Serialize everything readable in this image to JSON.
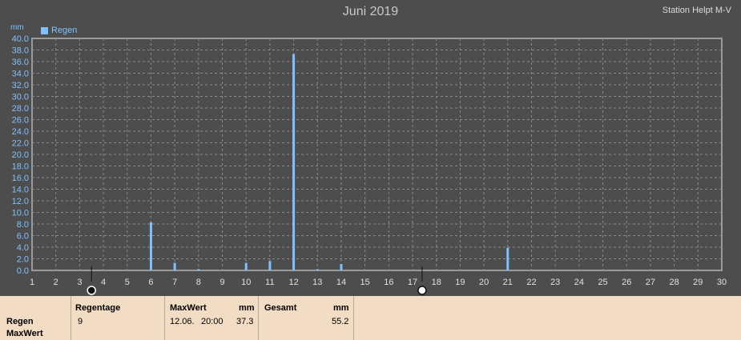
{
  "title": "Juni 2019",
  "station": "Station Helpt M-V",
  "unit": "mm",
  "legend_label": "Regen",
  "colors": {
    "bar": "#7fc0ff",
    "plot_bg": "#4d4d4d",
    "grid": "#8a8a8a",
    "panel_bg": "#f2dcc4"
  },
  "chart_data": {
    "type": "bar",
    "title": "Juni 2019",
    "ylabel": "mm",
    "xlabel": "",
    "series": [
      {
        "name": "Regen",
        "points": [
          {
            "x": 6,
            "y": 8.3
          },
          {
            "x": 7,
            "y": 1.3
          },
          {
            "x": 8,
            "y": 0.2
          },
          {
            "x": 10,
            "y": 1.3
          },
          {
            "x": 11,
            "y": 1.6
          },
          {
            "x": 12,
            "y": 37.3
          },
          {
            "x": 13,
            "y": 0.2
          },
          {
            "x": 14,
            "y": 1.1
          },
          {
            "x": 21,
            "y": 3.9
          }
        ]
      }
    ],
    "xlim": [
      1,
      30
    ],
    "xticks": [
      1,
      2,
      3,
      4,
      5,
      6,
      7,
      8,
      9,
      10,
      11,
      12,
      13,
      14,
      15,
      16,
      17,
      18,
      19,
      20,
      21,
      22,
      23,
      24,
      25,
      26,
      27,
      28,
      29,
      30
    ],
    "ylim": [
      0,
      40
    ],
    "yticks": [
      "0.0",
      "2.0",
      "4.0",
      "6.0",
      "8.0",
      "10.0",
      "12.0",
      "14.0",
      "16.0",
      "18.0",
      "20.0",
      "22.0",
      "24.0",
      "26.0",
      "28.0",
      "30.0",
      "32.0",
      "34.0",
      "36.0",
      "38.0",
      "40.0"
    ],
    "grid": true,
    "markers": [
      {
        "x": 3.5,
        "icon": "new-moon-icon"
      },
      {
        "x": 17.4,
        "icon": "full-moon-icon"
      }
    ]
  },
  "stats": {
    "row_labels": [
      "Regen",
      "MaxWert"
    ],
    "regentage": {
      "header": "Regentage",
      "value": "9"
    },
    "maxwert": {
      "header": "MaxWert",
      "unit": "mm",
      "date": "12.06.",
      "time": "20:00",
      "value": "37.3"
    },
    "gesamt": {
      "header": "Gesamt",
      "unit": "mm",
      "value": "55.2"
    }
  }
}
